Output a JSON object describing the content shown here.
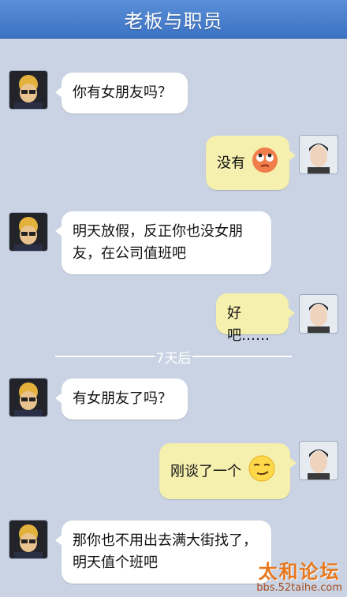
{
  "header": {
    "title": "老板与职员"
  },
  "messages": [
    {
      "side": "left",
      "text": "你有女朋友吗？"
    },
    {
      "side": "right",
      "text": "没有",
      "emoji": "rolling-eyes-emoji"
    },
    {
      "side": "left",
      "text": "明天放假，反正你也没女朋友，在公司值班吧"
    },
    {
      "side": "right",
      "text": "好吧……"
    },
    {
      "side": "left",
      "text": "有女朋友了吗？"
    },
    {
      "side": "right",
      "text": "刚谈了一个",
      "emoji": "smirk-emoji"
    },
    {
      "side": "left",
      "text": "那你也不用出去满大街找了，明天值个班吧"
    }
  ],
  "divider": {
    "text": "7天后"
  },
  "watermark": {
    "title": "太和论坛",
    "url": "bbs.52taihe.com"
  },
  "colors": {
    "header": "#3b72c4",
    "background": "#c9d3e3",
    "left_bubble": "#ffffff",
    "right_bubble": "#f5f0ae"
  }
}
